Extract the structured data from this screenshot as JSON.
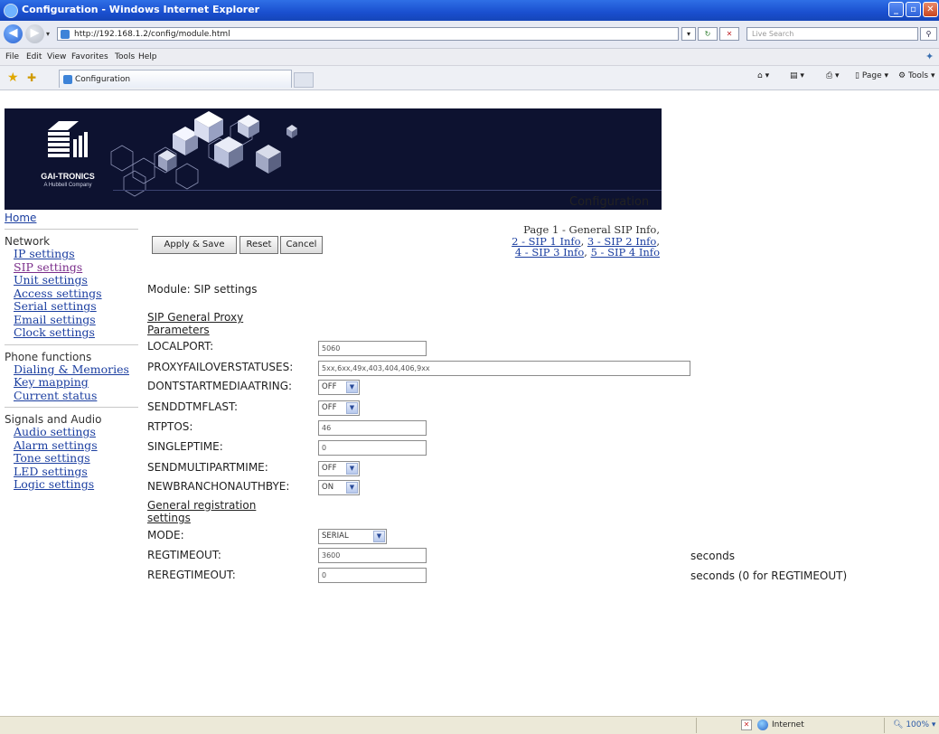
{
  "window": {
    "title": "Configuration - Windows Internet Explorer"
  },
  "address": {
    "url": "http://192.168.1.2/config/module.html",
    "search_placeholder": "Live Search"
  },
  "menu": [
    "File",
    "Edit",
    "View",
    "Favorites",
    "Tools",
    "Help"
  ],
  "tab": {
    "label": "Configuration"
  },
  "commands": {
    "page": "Page",
    "tools": "Tools"
  },
  "logo": {
    "name": "GAI-TRONICS",
    "subtitle": "A Hubbell Company"
  },
  "page": {
    "title": "Configuration",
    "module_label": "Module: SIP settings",
    "pages": {
      "current": "Page 1 - General SIP Info,",
      "links": [
        "2 - SIP 1 Info",
        "3 - SIP 2 Info",
        "4 - SIP 3 Info",
        "5 - SIP 4 Info"
      ]
    }
  },
  "nav": {
    "home": "Home",
    "network": {
      "label": "Network",
      "items": [
        "IP settings",
        "SIP settings",
        "Unit settings",
        "Access settings",
        "Serial settings",
        "Email settings",
        "Clock settings"
      ]
    },
    "phone": {
      "label": "Phone functions",
      "items": [
        "Dialing & Memories",
        "Key mapping",
        "Current status"
      ]
    },
    "signals": {
      "label": "Signals and Audio",
      "items": [
        "Audio settings",
        "Alarm settings",
        "Tone settings",
        "LED settings",
        "Logic settings"
      ]
    }
  },
  "buttons": {
    "apply": "Apply & Save",
    "reset": "Reset",
    "cancel": "Cancel"
  },
  "sections": {
    "proxy": "SIP General Proxy Parameters",
    "registration": "General registration settings"
  },
  "fields": {
    "localport": {
      "label": "LOCALPORT:",
      "value": "5060"
    },
    "proxyfailover": {
      "label": "PROXYFAILOVERSTATUSES:",
      "value": "5xx,6xx,49x,403,404,406,9xx"
    },
    "dontstartmedia": {
      "label": "DONTSTARTMEDIAATRING:",
      "value": "OFF"
    },
    "senddtmflast": {
      "label": "SENDDTMFLAST:",
      "value": "OFF"
    },
    "rtptos": {
      "label": "RTPTOS:",
      "value": "46"
    },
    "singleptime": {
      "label": "SINGLEPTIME:",
      "value": "0"
    },
    "sendmultipartmime": {
      "label": "SENDMULTIPARTMIME:",
      "value": "OFF"
    },
    "newbranchonauthbye": {
      "label": "NEWBRANCHONAUTHBYE:",
      "value": "ON"
    },
    "mode": {
      "label": "MODE:",
      "value": "SERIAL"
    },
    "regtimeout": {
      "label": "REGTIMEOUT:",
      "value": "3600",
      "unit": "seconds"
    },
    "reregtimeout": {
      "label": "REREGTIMEOUT:",
      "value": "0",
      "unit": "seconds (0 for REGTIMEOUT)"
    }
  },
  "status": {
    "zone": "Internet",
    "zoom": "100%"
  }
}
